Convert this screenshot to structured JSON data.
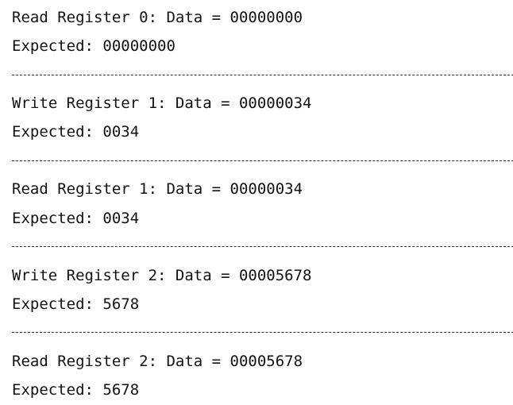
{
  "console": {
    "lines": [
      "Read Register 0: Data = 00000000",
      "Expected: 00000000",
      "Write Register 1: Data = 00000034",
      "Expected: 0034",
      "Read Register 1: Data = 00000034",
      "Expected: 0034",
      "Write Register 2: Data = 00005678",
      "Expected: 5678",
      "Read Register 2: Data = 00005678",
      "Expected: 5678"
    ]
  }
}
